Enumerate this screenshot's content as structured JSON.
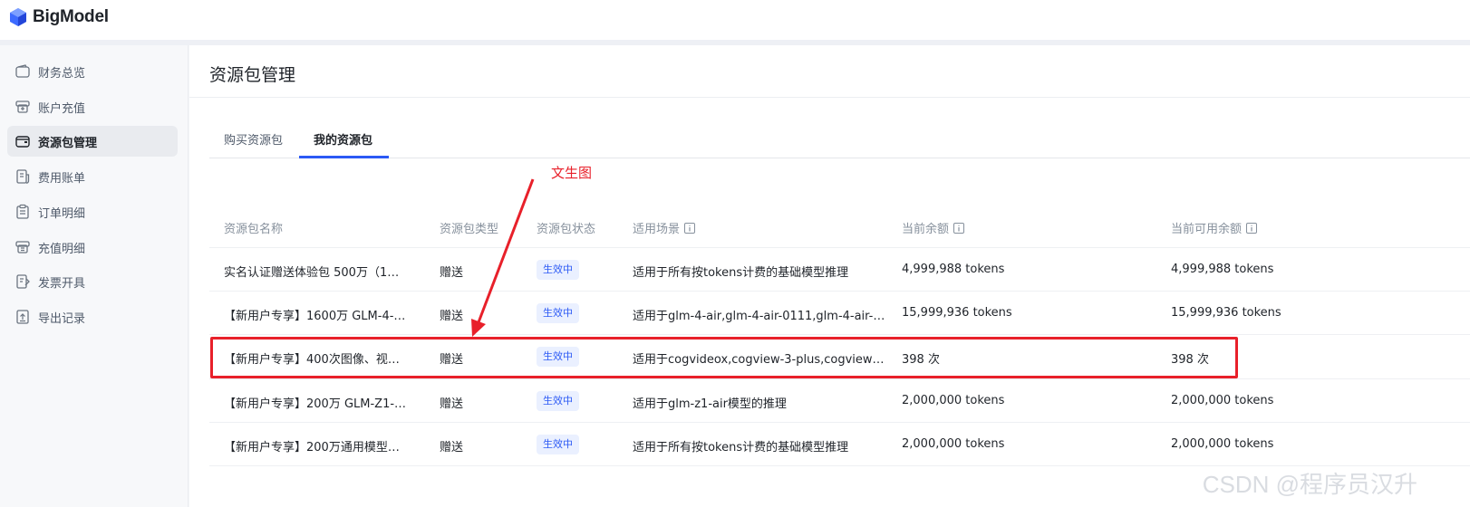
{
  "app": {
    "logo_text": "BigModel"
  },
  "sidebar": {
    "items": [
      {
        "label": "财务总览",
        "icon": "wallet-icon",
        "active": false
      },
      {
        "label": "账户充值",
        "icon": "recharge-icon",
        "active": false
      },
      {
        "label": "资源包管理",
        "icon": "package-icon",
        "active": true
      },
      {
        "label": "费用账单",
        "icon": "bill-icon",
        "active": false
      },
      {
        "label": "订单明细",
        "icon": "order-icon",
        "active": false
      },
      {
        "label": "充值明细",
        "icon": "recharge-detail-icon",
        "active": false
      },
      {
        "label": "发票开具",
        "icon": "invoice-icon",
        "active": false
      },
      {
        "label": "导出记录",
        "icon": "export-icon",
        "active": false
      }
    ]
  },
  "main": {
    "title": "资源包管理",
    "tabs": [
      {
        "label": "购买资源包",
        "active": false
      },
      {
        "label": "我的资源包",
        "active": true
      }
    ],
    "table": {
      "columns": [
        "资源包名称",
        "资源包类型",
        "资源包状态",
        "适用场景",
        "当前余额",
        "当前可用余额"
      ],
      "rows": [
        {
          "name": "实名认证赠送体验包 500万（1…",
          "type": "赠送",
          "status": "生效中",
          "scope": "适用于所有按tokens计费的基础模型推理",
          "balance": "4,999,988 tokens",
          "available": "4,999,988 tokens"
        },
        {
          "name": "【新用户专享】1600万 GLM-4-…",
          "type": "赠送",
          "status": "生效中",
          "scope": "适用于glm-4-air,glm-4-air-0111,glm-4-air-…",
          "balance": "15,999,936 tokens",
          "available": "15,999,936 tokens"
        },
        {
          "name": "【新用户专享】400次图像、视…",
          "type": "赠送",
          "status": "生效中",
          "scope": "适用于cogvideox,cogview-3-plus,cogview…",
          "balance": "398 次",
          "available": "398 次"
        },
        {
          "name": "【新用户专享】200万 GLM-Z1-…",
          "type": "赠送",
          "status": "生效中",
          "scope": "适用于glm-z1-air模型的推理",
          "balance": "2,000,000 tokens",
          "available": "2,000,000 tokens"
        },
        {
          "name": "【新用户专享】200万通用模型…",
          "type": "赠送",
          "status": "生效中",
          "scope": "适用于所有按tokens计费的基础模型推理",
          "balance": "2,000,000 tokens",
          "available": "2,000,000 tokens"
        }
      ]
    }
  },
  "annotation": {
    "text": "文生图",
    "color": "#e8202a"
  },
  "watermark": "CSDN @程序员汉升",
  "colors": {
    "accent": "#2b59f5",
    "highlight": "#e8202a"
  }
}
